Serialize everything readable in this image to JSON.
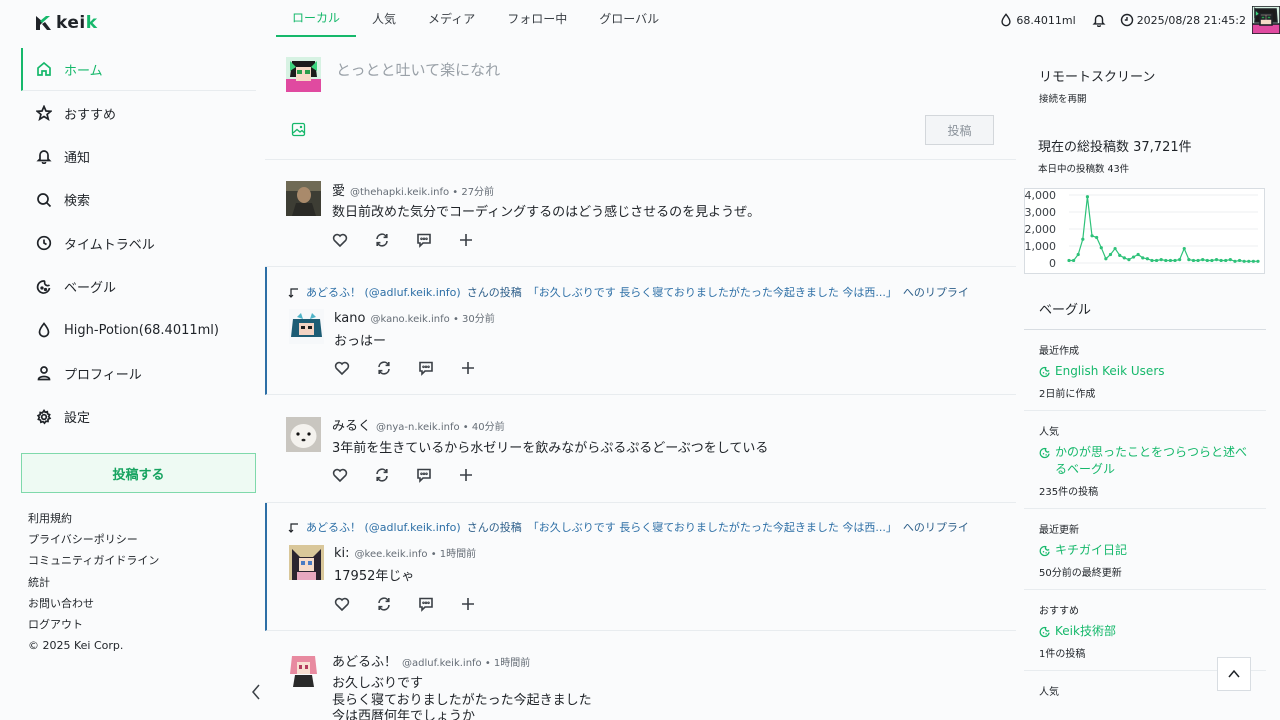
{
  "brand": {
    "name_k": "kei",
    "name_rest": "k",
    "accent": "#16b86b"
  },
  "nav": {
    "items": [
      {
        "label": "ホーム",
        "icon": "home-icon"
      },
      {
        "label": "おすすめ",
        "icon": "star-icon"
      },
      {
        "label": "通知",
        "icon": "bell-icon"
      },
      {
        "label": "検索",
        "icon": "search-icon"
      },
      {
        "label": "タイムトラベル",
        "icon": "clock-icon"
      },
      {
        "label": "ベーグル",
        "icon": "beagle-icon"
      },
      {
        "label": "High-Potion(68.4011ml)",
        "icon": "drop-icon"
      },
      {
        "label": "プロフィール",
        "icon": "user-icon"
      },
      {
        "label": "設定",
        "icon": "gear-icon"
      }
    ],
    "post_button": "投稿する"
  },
  "footer": {
    "links": [
      "利用規約",
      "プライバシーポリシー",
      "コミュニティガイドライン",
      "統計",
      "お問い合わせ",
      "ログアウト",
      "© 2025 Kei Corp."
    ]
  },
  "tabs": [
    "ローカル",
    "人気",
    "メディア",
    "フォロー中",
    "グローバル"
  ],
  "composer": {
    "placeholder": "とっとと吐いて楽になれ",
    "submit": "投稿"
  },
  "status": {
    "potion": "68.4011ml",
    "datetime": "2025/08/28 21:45:2"
  },
  "posts": [
    {
      "name": "愛",
      "acct": "@thehapki.keik.info • 27分前",
      "body": [
        "数日前改めた気分でコーディングするのはどう感じさせるのを見ようぜ。"
      ]
    },
    {
      "reply_user": "あどるふ！ (@adluf.keik.info)",
      "reply_mid": " さんの投稿",
      "reply_quote": "「お久しぶりです 長らく寝ておりましたがたった今起きました 今は西...」",
      "reply_tail": " へのリプライ",
      "name": "kano",
      "acct": "@kano.keik.info • 30分前",
      "body": [
        "おっはー"
      ]
    },
    {
      "name": "みるく",
      "acct": "@nya-n.keik.info • 40分前",
      "body": [
        "3年前を生きているから水ゼリーを飲みながらぷるぷるどーぶつをしている"
      ]
    },
    {
      "reply_user": "あどるふ！ (@adluf.keik.info)",
      "reply_mid": " さんの投稿",
      "reply_quote": "「お久しぶりです 長らく寝ておりましたがたった今起きました 今は西...」",
      "reply_tail": " へのリプライ",
      "name": "ki:",
      "acct": "@kee.keik.info • 1時間前",
      "body": [
        "17952年じゃ"
      ]
    },
    {
      "name": "あどるふ！",
      "acct": "@adluf.keik.info • 1時間前",
      "body": [
        "お久しぶりです",
        "長らく寝ておりましたがたった今起きました",
        "今は西暦何年でしょうか"
      ]
    }
  ],
  "remote": {
    "title": "リモートスクリーン",
    "sub": "接続を再開"
  },
  "stats": {
    "title": "現在の総投稿数 37,721件",
    "sub": "本日中の投稿数 43件"
  },
  "chart_data": {
    "type": "line",
    "ylim": [
      0,
      4000
    ],
    "yticks": [
      "4,000",
      "3,000",
      "2,000",
      "1,000",
      "0"
    ],
    "values": [
      150,
      150,
      500,
      1400,
      3900,
      1600,
      1500,
      900,
      250,
      500,
      850,
      450,
      300,
      200,
      350,
      500,
      300,
      250,
      150,
      150,
      200,
      150,
      150,
      150,
      200,
      850,
      200,
      150,
      150,
      200,
      150,
      150,
      200,
      150,
      150,
      200,
      100,
      150,
      100,
      100,
      100,
      100
    ]
  },
  "beagle": {
    "title": "ベーグル",
    "rows": [
      {
        "label": "最近作成",
        "link": "English Keik Users",
        "meta": "2日前に作成"
      },
      {
        "label": "人気",
        "link": "かのが思ったことをつらつらと述べるベーグル",
        "meta": "235件の投稿"
      },
      {
        "label": "最近更新",
        "link": "キチガイ日記",
        "meta": "50分前の最終更新"
      },
      {
        "label": "おすすめ",
        "link": "Keik技術部",
        "meta": "1件の投稿"
      },
      {
        "label": "人気",
        "link": "",
        "meta": ""
      }
    ]
  }
}
